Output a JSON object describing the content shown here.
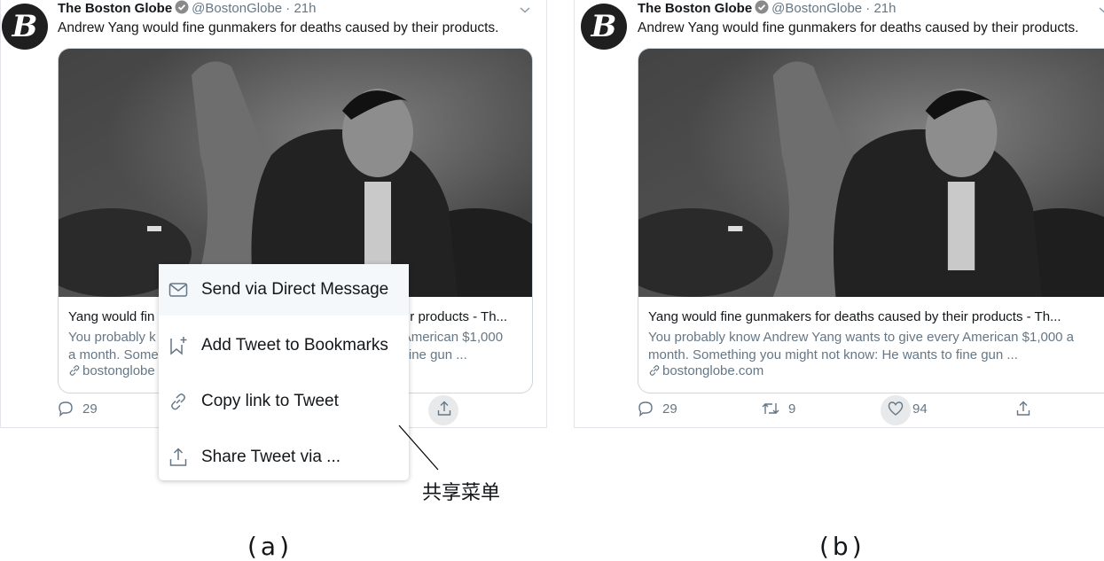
{
  "tweet": {
    "avatar_letter": "B",
    "name": "The Boston Globe",
    "handle_time": "@BostonGlobe · 21h",
    "text": "Andrew Yang would fine gunmakers for deaths caused by their products.",
    "card": {
      "title": "Yang would fine gunmakers for deaths caused by their products - Th...",
      "description": "You probably know Andrew Yang wants to give every American $1,000 a month. Something you might not know: He wants to fine gun ...",
      "domain": "bostonglobe.com",
      "title_a": "Yang would fin",
      "title_a_tail": "r products - Th...",
      "desc_a_1": "You probably k",
      "desc_a_1_tail": "American $1,000",
      "desc_a_2": "a month. Some",
      "desc_a_2_tail": "fine gun ...",
      "domain_a": "bostonglobe"
    },
    "replies": "29",
    "retweets": "9",
    "likes": "94"
  },
  "share_menu": {
    "items": [
      {
        "icon": "envelope-icon",
        "label": "Send via Direct Message"
      },
      {
        "icon": "bookmark-add-icon",
        "label": "Add Tweet to Bookmarks"
      },
      {
        "icon": "link-icon",
        "label": "Copy link to Tweet"
      },
      {
        "icon": "share-icon",
        "label": "Share Tweet via ..."
      }
    ]
  },
  "annotation": "共享菜单",
  "figure_labels": {
    "a": "(a)",
    "b": "(b)"
  },
  "colors": {
    "text": "#14171a",
    "secondary": "#657786",
    "border": "#ccd6dd",
    "verified": "#8a8a8a"
  }
}
